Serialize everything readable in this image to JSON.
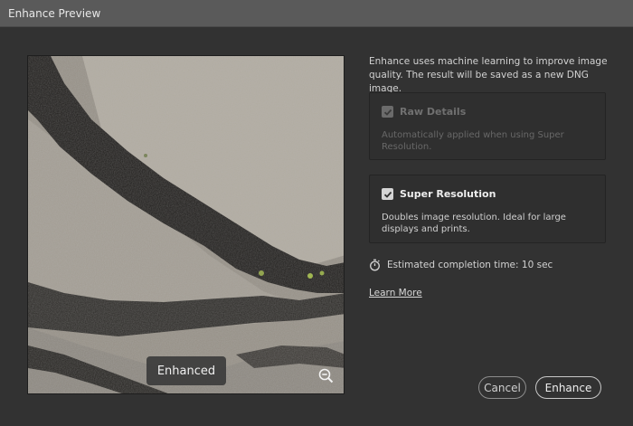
{
  "window": {
    "title": "Enhance Preview"
  },
  "preview": {
    "label": "Enhanced",
    "zoom_icon": "zoom-out-icon"
  },
  "intro_text": "Enhance uses machine learning to improve image quality. The result will be saved as a new DNG image.",
  "options": {
    "raw_details": {
      "title": "Raw Details",
      "checked": true,
      "disabled": true,
      "description": "Automatically applied when using Super Resolution."
    },
    "super_resolution": {
      "title": "Super Resolution",
      "checked": true,
      "disabled": false,
      "description": "Doubles image resolution. Ideal for large displays and prints."
    }
  },
  "estimate": {
    "icon": "stopwatch-icon",
    "text": "Estimated completion time: 10 sec"
  },
  "links": {
    "learn_more": "Learn More"
  },
  "buttons": {
    "cancel": "Cancel",
    "enhance": "Enhance"
  },
  "colors": {
    "background": "#323232",
    "titlebar": "#5a5a5a",
    "panel_border": "#242424"
  }
}
